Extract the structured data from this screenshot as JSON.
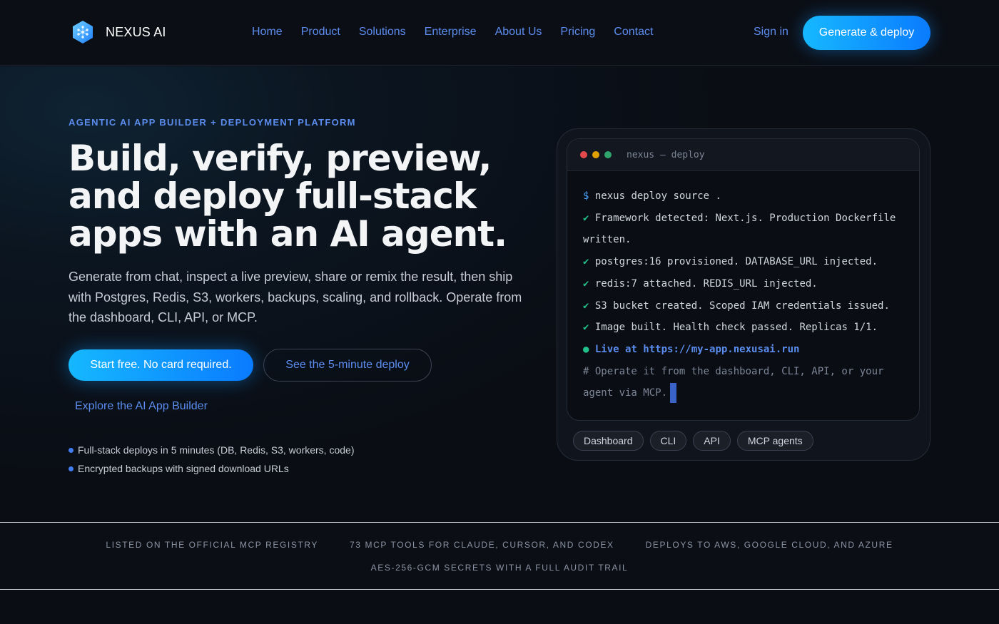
{
  "brand": {
    "name": "NEXUS AI",
    "accent": "#5b8def",
    "cta_gradient": [
      "#16b8ff",
      "#0a7bff"
    ]
  },
  "nav": {
    "links": [
      "Home",
      "Product",
      "Solutions",
      "Enterprise",
      "About Us",
      "Pricing",
      "Contact"
    ],
    "sign_in": "Sign in",
    "cta": "Generate & deploy"
  },
  "hero": {
    "eyebrow": "AGENTIC AI APP BUILDER + DEPLOYMENT PLATFORM",
    "headline": "Build, verify, preview, and deploy full-stack apps with an AI agent.",
    "subhead": "Generate from chat, inspect a live preview, share or remix the result, then ship with Postgres, Redis, S3, workers, backups, scaling, and rollback. Operate from the dashboard, CLI, API, or MCP.",
    "primary_cta": "Start free. No card required.",
    "secondary_cta": "See the 5-minute deploy",
    "explore_link": "Explore the AI App Builder",
    "bullets": [
      "Full-stack deploys in 5 minutes (DB, Redis, S3, workers, code)",
      "Encrypted backups with signed download URLs"
    ]
  },
  "terminal": {
    "title": "nexus — deploy",
    "window_dots": [
      "#e5484d",
      "#e0a100",
      "#30a46c"
    ],
    "prompt_symbol": "$",
    "command": "nexus deploy source .",
    "check": "✔",
    "lines": [
      "Framework detected: Next.js. Production Dockerfile written.",
      "postgres:16 provisioned. DATABASE_URL injected.",
      "redis:7 attached. REDIS_URL injected.",
      "S3 bucket created. Scoped IAM credentials issued.",
      "Image built. Health check passed. Replicas 1/1."
    ],
    "live_dot": "●",
    "live_text": "Live at https://my-app.nexusai.run",
    "comment": "# Operate it from the dashboard, CLI, API, or your agent via MCP.",
    "chips": [
      "Dashboard",
      "CLI",
      "API",
      "MCP agents"
    ]
  },
  "trust": {
    "row1": [
      "LISTED ON THE OFFICIAL MCP REGISTRY",
      "73 MCP TOOLS FOR CLAUDE, CURSOR, AND CODEX",
      "DEPLOYS TO AWS, GOOGLE CLOUD, AND AZURE"
    ],
    "row2": [
      "AES-256-GCM SECRETS WITH A FULL AUDIT TRAIL"
    ]
  },
  "icons": {
    "logo": "hexagon-logo-icon",
    "bullet": "bullet-dot-icon"
  }
}
